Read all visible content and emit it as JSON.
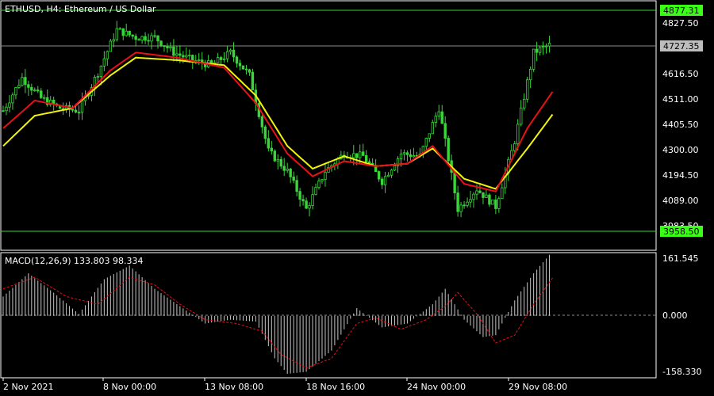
{
  "colors": {
    "background": "#000000",
    "frame": "#ffffff",
    "candle": "#39d639",
    "level_line": "#39d639",
    "last_price_line": "#8a8a8a",
    "ma_fast": "#e8101a",
    "ma_slow": "#f2f20a",
    "macd_hist": "#c8c8c8",
    "macd_signal": "#e8101a",
    "label_green_bg": "#39ff14",
    "label_gray_bg": "#bdbdbd"
  },
  "chart_data": [
    {
      "type": "candlestick",
      "title": "ETHUSD, H4:  Ethereum / US Dollar",
      "ylim": [
        3917,
        4905
      ],
      "price_ticks": [
        "4827.50",
        "4616.50",
        "4511.00",
        "4405.50",
        "4300.00",
        "4194.50",
        "4089.00",
        "3983.50"
      ],
      "level_labels": {
        "upper": "4877.31",
        "lower": "3958.50"
      },
      "last_price_label": "4727.35",
      "x_ticks": [
        "2 Nov 2021",
        "8 Nov 00:00",
        "13 Nov 08:00",
        "18 Nov 16:00",
        "24 Nov 00:00",
        "29 Nov 08:00"
      ],
      "candle_count": 174,
      "close_anchors": [
        [
          0,
          4470
        ],
        [
          6,
          4600
        ],
        [
          12,
          4520
        ],
        [
          18,
          4480
        ],
        [
          24,
          4470
        ],
        [
          30,
          4620
        ],
        [
          36,
          4790
        ],
        [
          42,
          4760
        ],
        [
          48,
          4760
        ],
        [
          54,
          4700
        ],
        [
          60,
          4670
        ],
        [
          66,
          4650
        ],
        [
          72,
          4700
        ],
        [
          78,
          4610
        ],
        [
          84,
          4310
        ],
        [
          90,
          4230
        ],
        [
          96,
          4080
        ],
        [
          102,
          4230
        ],
        [
          108,
          4300
        ],
        [
          114,
          4290
        ],
        [
          120,
          4190
        ],
        [
          126,
          4300
        ],
        [
          132,
          4290
        ],
        [
          138,
          4480
        ],
        [
          144,
          4080
        ],
        [
          150,
          4160
        ],
        [
          156,
          4090
        ],
        [
          162,
          4350
        ],
        [
          168,
          4700
        ],
        [
          173,
          4730
        ]
      ],
      "ma_fast_anchors": [
        [
          0,
          4400
        ],
        [
          10,
          4510
        ],
        [
          22,
          4480
        ],
        [
          34,
          4630
        ],
        [
          42,
          4700
        ],
        [
          55,
          4680
        ],
        [
          70,
          4640
        ],
        [
          80,
          4500
        ],
        [
          90,
          4300
        ],
        [
          98,
          4210
        ],
        [
          108,
          4270
        ],
        [
          118,
          4250
        ],
        [
          128,
          4260
        ],
        [
          136,
          4330
        ],
        [
          146,
          4180
        ],
        [
          156,
          4150
        ],
        [
          166,
          4400
        ],
        [
          174,
          4545
        ]
      ],
      "ma_slow_anchors": [
        [
          0,
          4330
        ],
        [
          10,
          4450
        ],
        [
          22,
          4480
        ],
        [
          34,
          4610
        ],
        [
          42,
          4680
        ],
        [
          55,
          4670
        ],
        [
          70,
          4650
        ],
        [
          80,
          4530
        ],
        [
          90,
          4330
        ],
        [
          98,
          4240
        ],
        [
          108,
          4290
        ],
        [
          118,
          4250
        ],
        [
          128,
          4260
        ],
        [
          136,
          4320
        ],
        [
          146,
          4200
        ],
        [
          156,
          4160
        ],
        [
          166,
          4320
        ],
        [
          174,
          4455
        ]
      ]
    },
    {
      "type": "bar",
      "title": "MACD(12,26,9) 133.803 98.334",
      "ylim": [
        -158.33,
        161.545
      ],
      "y_ticks": [
        "161.545",
        "0.000",
        "-158.330"
      ],
      "hist_anchors": [
        [
          0,
          50
        ],
        [
          8,
          110
        ],
        [
          16,
          60
        ],
        [
          24,
          5
        ],
        [
          32,
          95
        ],
        [
          40,
          130
        ],
        [
          48,
          70
        ],
        [
          56,
          25
        ],
        [
          64,
          -20
        ],
        [
          72,
          -10
        ],
        [
          80,
          -15
        ],
        [
          86,
          -110
        ],
        [
          90,
          -150
        ],
        [
          96,
          -145
        ],
        [
          104,
          -90
        ],
        [
          112,
          20
        ],
        [
          120,
          -30
        ],
        [
          128,
          -20
        ],
        [
          136,
          30
        ],
        [
          140,
          70
        ],
        [
          146,
          -10
        ],
        [
          152,
          -55
        ],
        [
          156,
          -50
        ],
        [
          162,
          40
        ],
        [
          168,
          110
        ],
        [
          173,
          158
        ]
      ],
      "signal_anchors": [
        [
          0,
          70
        ],
        [
          10,
          100
        ],
        [
          20,
          50
        ],
        [
          30,
          30
        ],
        [
          40,
          100
        ],
        [
          48,
          80
        ],
        [
          56,
          30
        ],
        [
          64,
          -10
        ],
        [
          74,
          -20
        ],
        [
          82,
          -40
        ],
        [
          88,
          -100
        ],
        [
          96,
          -135
        ],
        [
          104,
          -110
        ],
        [
          112,
          -20
        ],
        [
          118,
          -5
        ],
        [
          126,
          -35
        ],
        [
          134,
          -10
        ],
        [
          140,
          25
        ],
        [
          144,
          60
        ],
        [
          150,
          5
        ],
        [
          156,
          -70
        ],
        [
          162,
          -50
        ],
        [
          168,
          30
        ],
        [
          174,
          98
        ]
      ]
    }
  ]
}
